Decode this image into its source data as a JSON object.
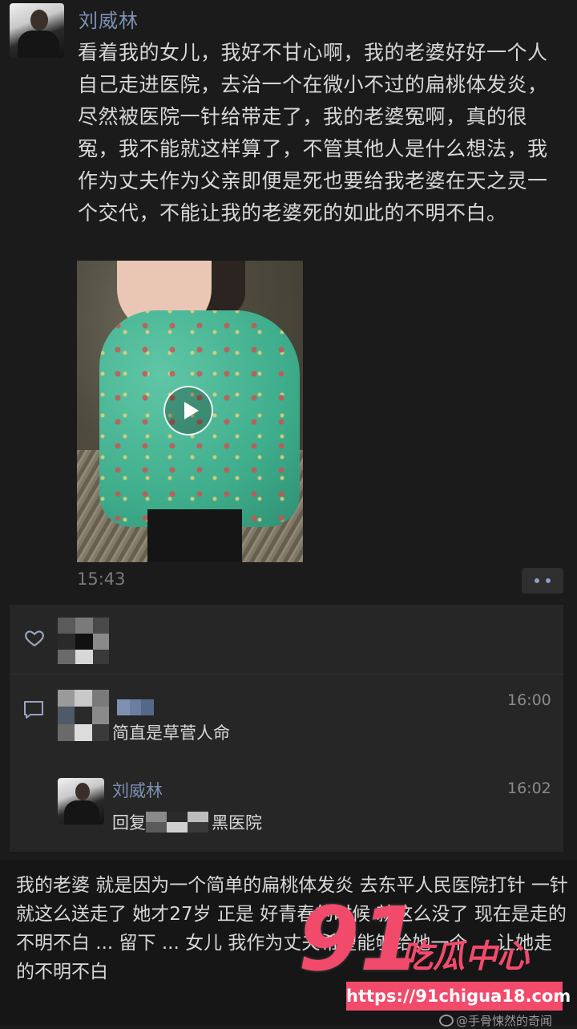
{
  "post": {
    "author": "刘威林",
    "text": "看着我的女儿，我好不甘心啊，我的老婆好好一个人自己走进医院，去治一个在微小不过的扁桃体发炎，尽然被医院一针给带走了，我的老婆冤啊，真的很冤，我不能就这样算了，不管其他人是什么想法，我作为丈夫作为父亲即便是死也要给我老婆在天之灵一个交代，不能让我的老婆死的如此的不明不白。",
    "time": "15:43"
  },
  "comments": [
    {
      "text": "简直是草菅人命",
      "time": "16:00"
    },
    {
      "author": "刘威林",
      "reply_prefix": "回复",
      "reply_suffix": "黑医院",
      "time": "16:02"
    }
  ],
  "bottom_text": "我的老婆 就是因为一个简单的扁桃体发炎 去东平人民医院打针 一针就这么送走了 她才27岁 正是 好青春的时候 就这么没了 现在是走的不明不白 ... 留下 ... 女儿 我作为丈夫希望能够给她一个 ... 让她走的不明不白",
  "watermark": {
    "number": "91",
    "name": "吃瓜中心",
    "url": "https://91chigua18.com"
  },
  "weibo_credit": "@手骨悚然的奇闻",
  "colors": {
    "accent_name": "#7d8fb3",
    "watermark": "#f24a6b",
    "background": "#1b1b1b"
  },
  "icons": [
    "heart-icon",
    "comment-icon",
    "play-icon",
    "more-icon",
    "weibo-icon"
  ]
}
